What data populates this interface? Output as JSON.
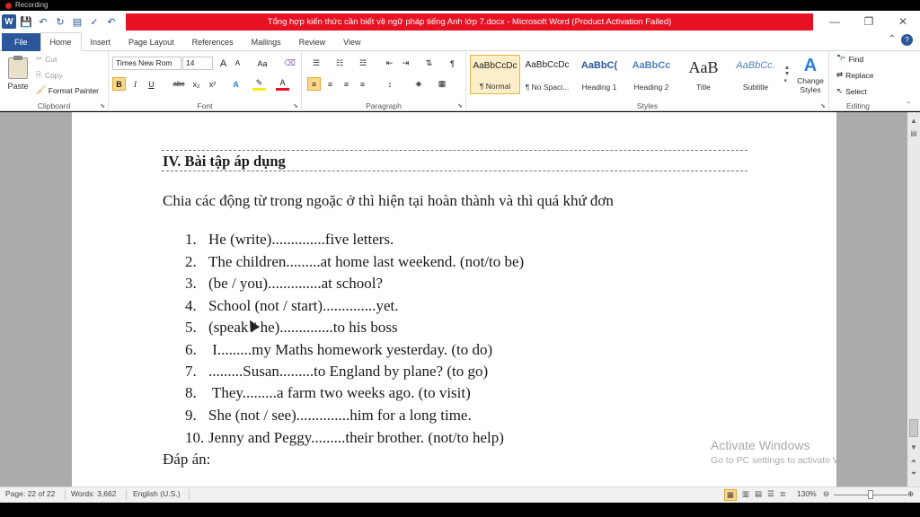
{
  "recording": {
    "label": "Recording"
  },
  "window": {
    "title": "Tổng hợp kiến thức cần biết về ngữ pháp tiếng Anh lớp 7.docx  -  Microsoft Word (Product Activation Failed)"
  },
  "qat": {
    "save_icon": "save-icon",
    "undo_icon": "undo-icon",
    "redo_icon": "redo-icon"
  },
  "tabs": [
    {
      "label": "File"
    },
    {
      "label": "Home"
    },
    {
      "label": "Insert"
    },
    {
      "label": "Page Layout"
    },
    {
      "label": "References"
    },
    {
      "label": "Mailings"
    },
    {
      "label": "Review"
    },
    {
      "label": "View"
    }
  ],
  "clipboard": {
    "paste": "Paste",
    "cut": "Cut",
    "copy": "Copy",
    "format_painter": "Format Painter",
    "label": "Clipboard"
  },
  "font": {
    "name": "Times New Rom",
    "size": "14",
    "bold": "B",
    "italic": "I",
    "underline": "U",
    "strike": "abc",
    "subscript": "x₂",
    "superscript": "x²",
    "grow": "A",
    "shrink": "A",
    "change_case": "Aa",
    "label": "Font"
  },
  "paragraph": {
    "label": "Paragraph",
    "pilcrow": "¶"
  },
  "styles": {
    "label": "Styles",
    "items": [
      {
        "sample": "AaBbCcDc",
        "name": "¶ Normal"
      },
      {
        "sample": "AaBbCcDc",
        "name": "¶ No Spaci..."
      },
      {
        "sample": "AaBbC(",
        "name": "Heading 1"
      },
      {
        "sample": "AaBbCc",
        "name": "Heading 2"
      },
      {
        "sample": "AaB",
        "name": "Title"
      },
      {
        "sample": "AaBbCc.",
        "name": "Subtitle"
      }
    ],
    "change_styles": "Change Styles"
  },
  "editing": {
    "label": "Editing",
    "find": "Find",
    "replace": "Replace",
    "select": "Select"
  },
  "document": {
    "heading": "IV. Bài tập áp dụng",
    "instruction": "Chia các động từ trong ngoặc ở thì hiện tại hoàn thành và thì quá khứ đơn",
    "items": [
      {
        "num": "1.",
        "text": "He (write)..............five letters."
      },
      {
        "num": "2.",
        "text": "The children.........at home last weekend. (not/to be)"
      },
      {
        "num": "3.",
        "text": "(be / you)..............at school?"
      },
      {
        "num": "4.",
        "text": "School (not / start)..............yet."
      },
      {
        "num": "5.",
        "text": "(speak / he)..............to his boss"
      },
      {
        "num": "6.",
        "text": " I.........my Maths homework yesterday. (to do)"
      },
      {
        "num": "7.",
        "text": ".........Susan.........to England by plane? (to go)"
      },
      {
        "num": "8.",
        "text": " They.........a farm two weeks ago. (to visit)"
      },
      {
        "num": "9.",
        "text": "She (not / see)..............him for a long time."
      },
      {
        "num": "10.",
        "text": "Jenny and Peggy.........their brother. (not/to help)"
      }
    ],
    "answer_label": "Đáp án:"
  },
  "watermark": {
    "line1": "Activate Windows",
    "line2": "Go to PC settings to activate Windows."
  },
  "status": {
    "page": "Page: 22 of 22",
    "words": "Words: 3,662",
    "language": "English (U.S.)",
    "zoom": "130%"
  }
}
